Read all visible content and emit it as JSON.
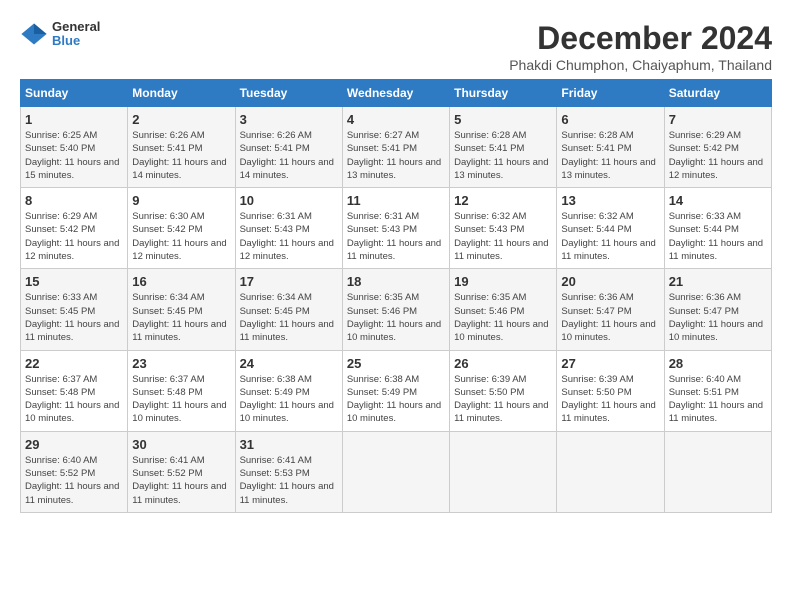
{
  "header": {
    "logo_general": "General",
    "logo_blue": "Blue",
    "month_title": "December 2024",
    "subtitle": "Phakdi Chumphon, Chaiyaphum, Thailand"
  },
  "weekdays": [
    "Sunday",
    "Monday",
    "Tuesday",
    "Wednesday",
    "Thursday",
    "Friday",
    "Saturday"
  ],
  "weeks": [
    [
      {
        "day": "1",
        "sunrise": "6:25 AM",
        "sunset": "5:40 PM",
        "daylight": "11 hours and 15 minutes."
      },
      {
        "day": "2",
        "sunrise": "6:26 AM",
        "sunset": "5:41 PM",
        "daylight": "11 hours and 14 minutes."
      },
      {
        "day": "3",
        "sunrise": "6:26 AM",
        "sunset": "5:41 PM",
        "daylight": "11 hours and 14 minutes."
      },
      {
        "day": "4",
        "sunrise": "6:27 AM",
        "sunset": "5:41 PM",
        "daylight": "11 hours and 13 minutes."
      },
      {
        "day": "5",
        "sunrise": "6:28 AM",
        "sunset": "5:41 PM",
        "daylight": "11 hours and 13 minutes."
      },
      {
        "day": "6",
        "sunrise": "6:28 AM",
        "sunset": "5:41 PM",
        "daylight": "11 hours and 13 minutes."
      },
      {
        "day": "7",
        "sunrise": "6:29 AM",
        "sunset": "5:42 PM",
        "daylight": "11 hours and 12 minutes."
      }
    ],
    [
      {
        "day": "8",
        "sunrise": "6:29 AM",
        "sunset": "5:42 PM",
        "daylight": "11 hours and 12 minutes."
      },
      {
        "day": "9",
        "sunrise": "6:30 AM",
        "sunset": "5:42 PM",
        "daylight": "11 hours and 12 minutes."
      },
      {
        "day": "10",
        "sunrise": "6:31 AM",
        "sunset": "5:43 PM",
        "daylight": "11 hours and 12 minutes."
      },
      {
        "day": "11",
        "sunrise": "6:31 AM",
        "sunset": "5:43 PM",
        "daylight": "11 hours and 11 minutes."
      },
      {
        "day": "12",
        "sunrise": "6:32 AM",
        "sunset": "5:43 PM",
        "daylight": "11 hours and 11 minutes."
      },
      {
        "day": "13",
        "sunrise": "6:32 AM",
        "sunset": "5:44 PM",
        "daylight": "11 hours and 11 minutes."
      },
      {
        "day": "14",
        "sunrise": "6:33 AM",
        "sunset": "5:44 PM",
        "daylight": "11 hours and 11 minutes."
      }
    ],
    [
      {
        "day": "15",
        "sunrise": "6:33 AM",
        "sunset": "5:45 PM",
        "daylight": "11 hours and 11 minutes."
      },
      {
        "day": "16",
        "sunrise": "6:34 AM",
        "sunset": "5:45 PM",
        "daylight": "11 hours and 11 minutes."
      },
      {
        "day": "17",
        "sunrise": "6:34 AM",
        "sunset": "5:45 PM",
        "daylight": "11 hours and 11 minutes."
      },
      {
        "day": "18",
        "sunrise": "6:35 AM",
        "sunset": "5:46 PM",
        "daylight": "11 hours and 10 minutes."
      },
      {
        "day": "19",
        "sunrise": "6:35 AM",
        "sunset": "5:46 PM",
        "daylight": "11 hours and 10 minutes."
      },
      {
        "day": "20",
        "sunrise": "6:36 AM",
        "sunset": "5:47 PM",
        "daylight": "11 hours and 10 minutes."
      },
      {
        "day": "21",
        "sunrise": "6:36 AM",
        "sunset": "5:47 PM",
        "daylight": "11 hours and 10 minutes."
      }
    ],
    [
      {
        "day": "22",
        "sunrise": "6:37 AM",
        "sunset": "5:48 PM",
        "daylight": "11 hours and 10 minutes."
      },
      {
        "day": "23",
        "sunrise": "6:37 AM",
        "sunset": "5:48 PM",
        "daylight": "11 hours and 10 minutes."
      },
      {
        "day": "24",
        "sunrise": "6:38 AM",
        "sunset": "5:49 PM",
        "daylight": "11 hours and 10 minutes."
      },
      {
        "day": "25",
        "sunrise": "6:38 AM",
        "sunset": "5:49 PM",
        "daylight": "11 hours and 10 minutes."
      },
      {
        "day": "26",
        "sunrise": "6:39 AM",
        "sunset": "5:50 PM",
        "daylight": "11 hours and 11 minutes."
      },
      {
        "day": "27",
        "sunrise": "6:39 AM",
        "sunset": "5:50 PM",
        "daylight": "11 hours and 11 minutes."
      },
      {
        "day": "28",
        "sunrise": "6:40 AM",
        "sunset": "5:51 PM",
        "daylight": "11 hours and 11 minutes."
      }
    ],
    [
      {
        "day": "29",
        "sunrise": "6:40 AM",
        "sunset": "5:52 PM",
        "daylight": "11 hours and 11 minutes."
      },
      {
        "day": "30",
        "sunrise": "6:41 AM",
        "sunset": "5:52 PM",
        "daylight": "11 hours and 11 minutes."
      },
      {
        "day": "31",
        "sunrise": "6:41 AM",
        "sunset": "5:53 PM",
        "daylight": "11 hours and 11 minutes."
      },
      null,
      null,
      null,
      null
    ]
  ]
}
